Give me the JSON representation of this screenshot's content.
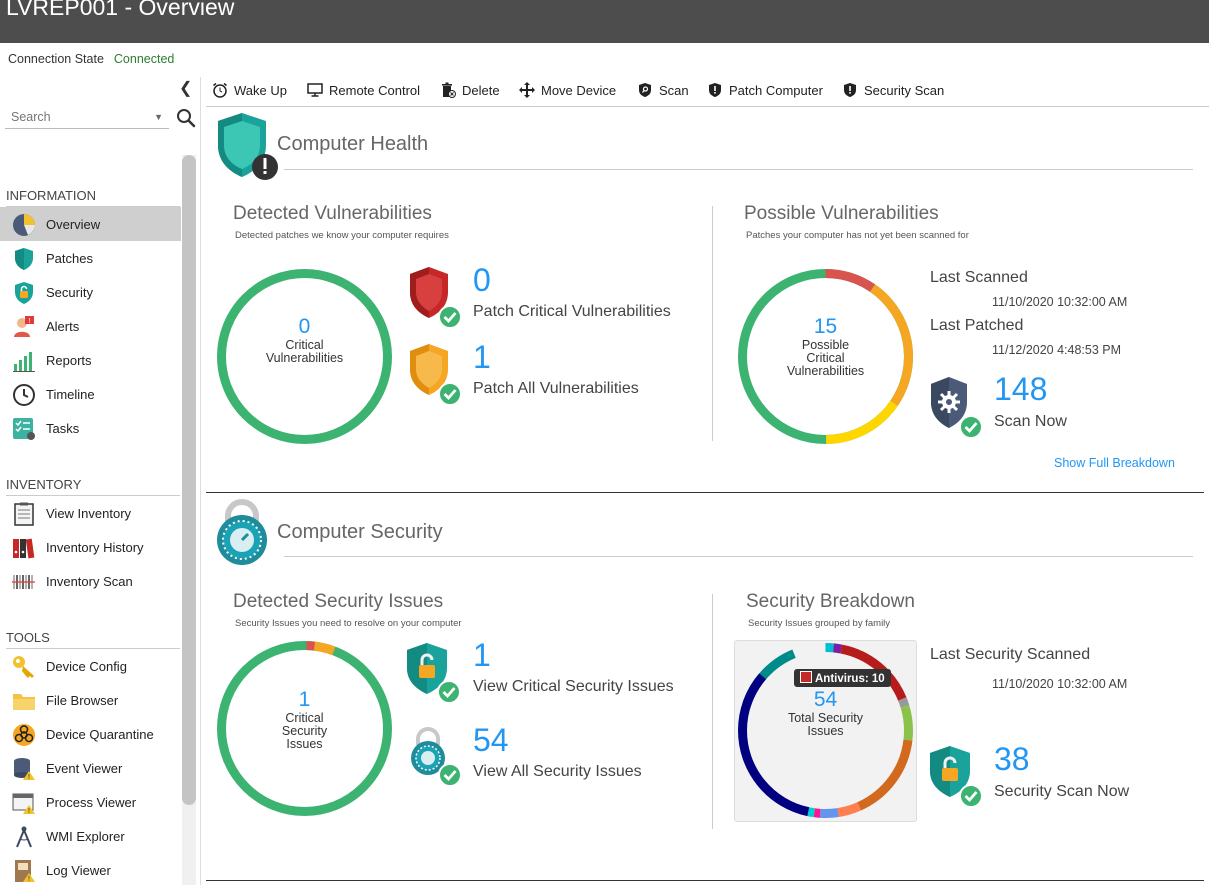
{
  "window": {
    "title": "LVREP001 - Overview"
  },
  "connection": {
    "label": "Connection State",
    "value": "Connected"
  },
  "search": {
    "placeholder": "Search"
  },
  "sidebar": {
    "sections": [
      {
        "title": "INFORMATION",
        "items": [
          {
            "label": "Overview",
            "icon": "pie-chart-icon"
          },
          {
            "label": "Patches",
            "icon": "shield-icon"
          },
          {
            "label": "Security",
            "icon": "lock-shield-icon"
          },
          {
            "label": "Alerts",
            "icon": "alert-icon"
          },
          {
            "label": "Reports",
            "icon": "bar-chart-icon"
          },
          {
            "label": "Timeline",
            "icon": "clock-icon"
          },
          {
            "label": "Tasks",
            "icon": "tasks-icon"
          }
        ]
      },
      {
        "title": "INVENTORY",
        "items": [
          {
            "label": "View Inventory",
            "icon": "clipboard-icon"
          },
          {
            "label": "Inventory History",
            "icon": "binders-icon"
          },
          {
            "label": "Inventory Scan",
            "icon": "barcode-icon"
          }
        ]
      },
      {
        "title": "TOOLS",
        "items": [
          {
            "label": "Device Config",
            "icon": "key-icon"
          },
          {
            "label": "File Browser",
            "icon": "folder-icon"
          },
          {
            "label": "Device Quarantine",
            "icon": "biohazard-icon"
          },
          {
            "label": "Event Viewer",
            "icon": "database-warning-icon"
          },
          {
            "label": "Process Viewer",
            "icon": "window-warning-icon"
          },
          {
            "label": "WMI Explorer",
            "icon": "compass-icon"
          },
          {
            "label": "Log Viewer",
            "icon": "book-icon"
          }
        ]
      }
    ]
  },
  "toolbar": {
    "items": [
      {
        "label": "Wake Up",
        "icon": "alarm-clock-icon"
      },
      {
        "label": "Remote Control",
        "icon": "monitor-icon"
      },
      {
        "label": "Delete",
        "icon": "trash-icon"
      },
      {
        "label": "Move Device",
        "icon": "move-icon"
      },
      {
        "label": "Scan",
        "icon": "scan-shield-icon"
      },
      {
        "label": "Patch Computer",
        "icon": "patch-shield-icon"
      },
      {
        "label": "Security Scan",
        "icon": "security-shield-icon"
      }
    ]
  },
  "health": {
    "title": "Computer Health",
    "detected": {
      "title": "Detected Vulnerabilities",
      "subtitle": "Detected patches we know your computer requires",
      "ring_value": "0",
      "ring_label_1": "Critical",
      "ring_label_2": "Vulnerabilities",
      "critical_count": "0",
      "critical_label": "Patch Critical Vulnerabilities",
      "all_count": "1",
      "all_label": "Patch All Vulnerabilities"
    },
    "possible": {
      "title": "Possible Vulnerabilities",
      "subtitle": "Patches your computer has not yet been scanned for",
      "ring_value": "15",
      "ring_label_1": "Possible",
      "ring_label_2": "Critical",
      "ring_label_3": "Vulnerabilities",
      "last_scanned_label": "Last Scanned",
      "last_scanned_value": "11/10/2020 10:32:00 AM",
      "last_patched_label": "Last Patched",
      "last_patched_value": "11/12/2020 4:48:53 PM",
      "scan_count": "148",
      "scan_label": "Scan Now",
      "breakdown_link": "Show Full Breakdown"
    }
  },
  "security": {
    "title": "Computer Security",
    "detected": {
      "title": "Detected Security Issues",
      "subtitle": "Security Issues you need to resolve on your computer",
      "ring_value": "1",
      "ring_label_1": "Critical",
      "ring_label_2": "Security",
      "ring_label_3": "Issues",
      "critical_count": "1",
      "critical_label": "View Critical Security Issues",
      "all_count": "54",
      "all_label": "View All Security Issues"
    },
    "breakdown": {
      "title": "Security Breakdown",
      "subtitle": "Security Issues grouped by family",
      "ring_value": "54",
      "ring_label_1": "Total Security",
      "ring_label_2": "Issues",
      "tooltip": "Antivirus: 10",
      "last_scanned_label": "Last Security Scanned",
      "last_scanned_value": "11/10/2020 10:32:00 AM",
      "scan_count": "38",
      "scan_label": "Security Scan Now"
    }
  },
  "colors": {
    "green": "#3cb371",
    "blue": "#2196f3",
    "red": "#c62828",
    "orange": "#f5a623",
    "teal": "#1aa39a",
    "header": "#4d4d4d"
  }
}
